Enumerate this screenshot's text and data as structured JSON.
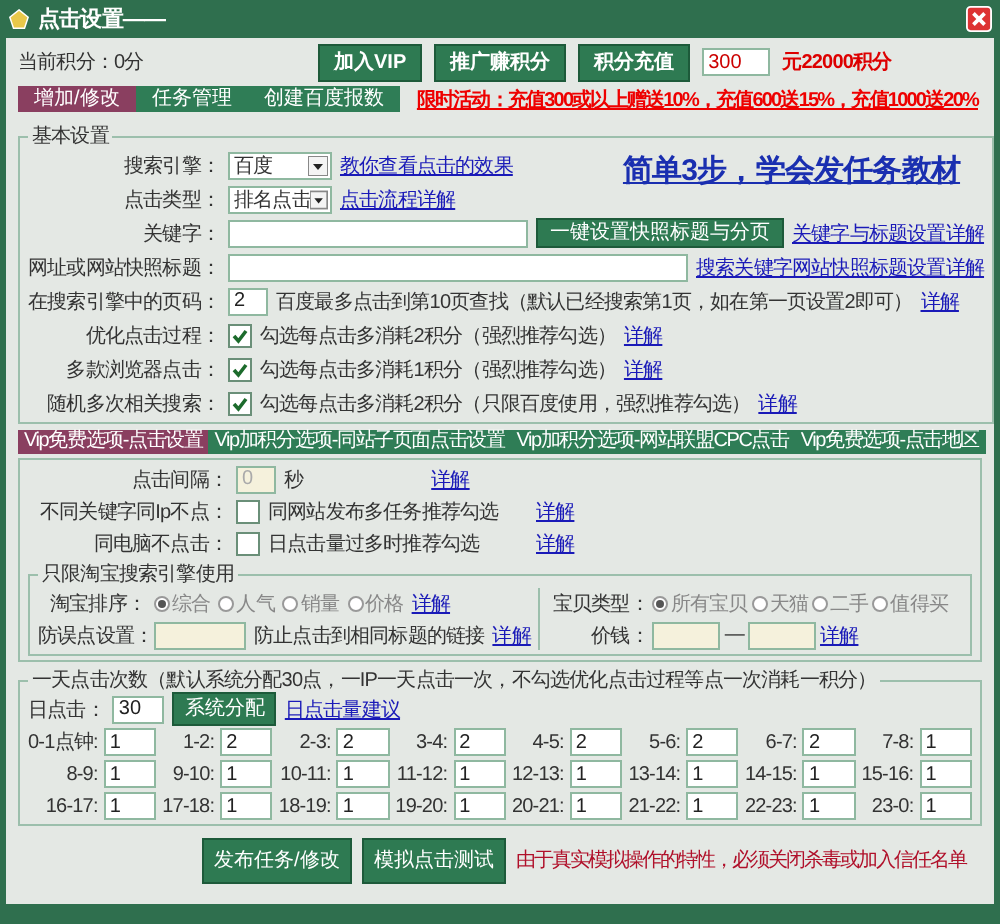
{
  "window": {
    "title": "点击设置——"
  },
  "header": {
    "points": "当前积分：0分",
    "buttons": [
      "加入VIP",
      "推广赚积分",
      "积分充值"
    ],
    "recharge_amount": "300",
    "recharge_note": "元22000积分"
  },
  "tabs": [
    {
      "label": "增加/修改",
      "selected": true
    },
    {
      "label": "任务管理",
      "selected": false
    },
    {
      "label": "创建百度报数",
      "selected": false
    }
  ],
  "promo_link": "限时活动：充值300或以上赠送10%，充值600送15%，充值1000送20%",
  "basic": {
    "legend": "基本设置",
    "tutorial_link": "简单3步，学会发任务教材",
    "rows": [
      {
        "kind": "select",
        "label": "搜索引擎：",
        "value": "百度",
        "link": "教你查看点击的效果"
      },
      {
        "kind": "select",
        "label": "点击类型：",
        "value": "排名点击",
        "link": "点击流程详解"
      },
      {
        "kind": "keyword",
        "label": "关键字：",
        "button": "一键设置快照标题与分页",
        "link": "关键字与标题设置详解"
      },
      {
        "kind": "url",
        "label": "网址或网站快照标题：",
        "link": "搜索关键字网站快照标题设置详解"
      },
      {
        "kind": "page",
        "label": "在搜索引擎中的页码：",
        "value": "2",
        "note": "百度最多点击到第10页查找（默认已经搜索第1页，如在第一页设置2即可）",
        "link": "详解"
      },
      {
        "kind": "check",
        "label": "优化点击过程：",
        "checked": true,
        "note": "勾选每点击多消耗2积分（强烈推荐勾选）",
        "link": "详解"
      },
      {
        "kind": "check",
        "label": "多款浏览器点击：",
        "checked": true,
        "note": "勾选每点击多消耗1积分（强烈推荐勾选）",
        "link": "详解"
      },
      {
        "kind": "check",
        "label": "随机多次相关搜索：",
        "checked": true,
        "note": "勾选每点击多消耗2积分（只限百度使用，强烈推荐勾选）",
        "link": "详解"
      }
    ]
  },
  "vip_tabs": [
    {
      "label": "Vip免费选项-点击设置",
      "selected": true
    },
    {
      "label": "Vip加积分选项-同站子页面点击设置",
      "selected": false
    },
    {
      "label": "Vip加积分选项-网站联盟CPC点击",
      "selected": false
    },
    {
      "label": "Vip免费选项-点击地区",
      "selected": false
    }
  ],
  "vip": {
    "rows": [
      {
        "kind": "interval",
        "label": "点击间隔：",
        "placeholder": "0",
        "unit": "秒",
        "link": "详解"
      },
      {
        "kind": "check",
        "label": "不同关键字同Ip不点：",
        "checked": false,
        "note": "同网站发布多任务推荐勾选",
        "link": "详解"
      },
      {
        "kind": "check",
        "label": "同电脑不点击：",
        "checked": false,
        "note": "日点击量过多时推荐勾选",
        "link": "详解"
      }
    ],
    "taobao": {
      "legend": "只限淘宝搜索引擎使用",
      "sort_label": "淘宝排序：",
      "sort_options": [
        {
          "label": "综合",
          "selected": true
        },
        {
          "label": "人气",
          "selected": false
        },
        {
          "label": "销量",
          "selected": false
        },
        {
          "label": "价格",
          "selected": false
        }
      ],
      "sort_link": "详解",
      "guard_label": "防误点设置：",
      "guard_note": "防止点击到相同标题的链接",
      "guard_link": "详解",
      "type_label": "宝贝类型：",
      "type_options": [
        {
          "label": "所有宝贝",
          "selected": true
        },
        {
          "label": "天猫",
          "selected": false
        },
        {
          "label": "二手",
          "selected": false
        },
        {
          "label": "值得买",
          "selected": false
        }
      ],
      "price_label": "价钱：",
      "price_separator": "—",
      "price_link": "详解"
    }
  },
  "daily": {
    "legend": "一天点击次数（默认系统分配30点，一IP一天点击一次，不勾选优化点击过程等点一次消耗一积分）",
    "label": "日点击：",
    "value": "30",
    "button": "系统分配",
    "link": "日点击量建议",
    "hours": [
      {
        "label": "0-1点钟:",
        "value": "1"
      },
      {
        "label": "1-2:",
        "value": "2"
      },
      {
        "label": "2-3:",
        "value": "2"
      },
      {
        "label": "3-4:",
        "value": "2"
      },
      {
        "label": "4-5:",
        "value": "2"
      },
      {
        "label": "5-6:",
        "value": "2"
      },
      {
        "label": "6-7:",
        "value": "2"
      },
      {
        "label": "7-8:",
        "value": "1"
      },
      {
        "label": "8-9:",
        "value": "1"
      },
      {
        "label": "9-10:",
        "value": "1"
      },
      {
        "label": "10-11:",
        "value": "1"
      },
      {
        "label": "11-12:",
        "value": "1"
      },
      {
        "label": "12-13:",
        "value": "1"
      },
      {
        "label": "13-14:",
        "value": "1"
      },
      {
        "label": "14-15:",
        "value": "1"
      },
      {
        "label": "15-16:",
        "value": "1"
      },
      {
        "label": "16-17:",
        "value": "1"
      },
      {
        "label": "17-18:",
        "value": "1"
      },
      {
        "label": "18-19:",
        "value": "1"
      },
      {
        "label": "19-20:",
        "value": "1"
      },
      {
        "label": "20-21:",
        "value": "1"
      },
      {
        "label": "21-22:",
        "value": "1"
      },
      {
        "label": "22-23:",
        "value": "1"
      },
      {
        "label": "23-0:",
        "value": "1"
      }
    ]
  },
  "footer": {
    "buttons": [
      "发布任务/修改",
      "模拟点击测试"
    ],
    "warning": "由于真实模拟操作的特性，必须关闭杀毒或加入信任名单"
  }
}
